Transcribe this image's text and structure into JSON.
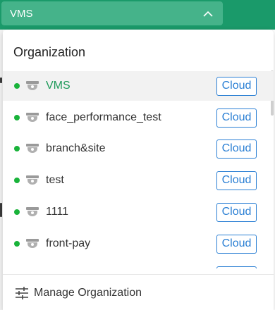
{
  "header": {
    "selected_org": "VMS",
    "chevron_icon": "chevron-up-icon",
    "bar_color": "#1a9a6a"
  },
  "dropdown": {
    "title": "Organization",
    "items": [
      {
        "name": "VMS",
        "badge": "Cloud",
        "status": "online",
        "selected": true
      },
      {
        "name": "face_performance_test",
        "badge": "Cloud",
        "status": "online",
        "selected": false
      },
      {
        "name": "branch&site",
        "badge": "Cloud",
        "status": "online",
        "selected": false
      },
      {
        "name": "test",
        "badge": "Cloud",
        "status": "online",
        "selected": false
      },
      {
        "name": "1111",
        "badge": "Cloud",
        "status": "online",
        "selected": false
      },
      {
        "name": "front-pay",
        "badge": "Cloud",
        "status": "online",
        "selected": false
      }
    ],
    "item_icon": "camera-icon",
    "footer": {
      "label": "Manage Organization",
      "icon": "sliders-icon"
    }
  },
  "colors": {
    "online": "#19b33a",
    "selected_text": "#1f9a5a",
    "badge": "#2a7fd4"
  }
}
